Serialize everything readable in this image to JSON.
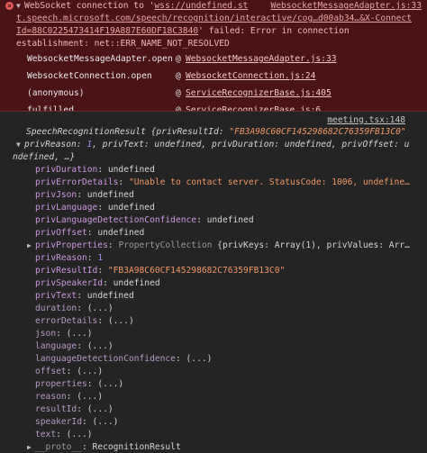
{
  "error": {
    "line1_prefix": "WebSocket connection to '",
    "line1_url": "wss://undefined.st",
    "line1_source": "WebsocketMessageAdapter.js:33",
    "line2": "t.speech.microsoft.com/speech/recognition/interactive/cog…d00ab34…&X-Connect",
    "line3_a": "Id=88C0225473414F19A887E60DF18C3840",
    "line3_b": "' failed: Error in connection",
    "line4": "establishment: net::ERR_NAME_NOT_RESOLVED",
    "stack": [
      {
        "fn": "WebsocketMessageAdapter.open",
        "at": "@",
        "src": "WebsocketMessageAdapter.js:33"
      },
      {
        "fn": "WebsocketConnection.open",
        "at": "@",
        "src": "WebsocketConnection.js:24"
      },
      {
        "fn": "(anonymous)",
        "at": "@",
        "src": "ServiceRecognizerBase.js:405"
      },
      {
        "fn": "fulfilled",
        "at": "@",
        "src": "ServiceRecognizerBase.js:6"
      }
    ]
  },
  "log": {
    "source": "meeting.tsx:148",
    "header_class": "SpeechRecognitionResult",
    "header_rest_a": " {privResultId: ",
    "header_id": "\"FB3A98C60CF145298682C76359FB13C0\"",
    "header_line2_a": "privReason: ",
    "header_line2_reason": "1",
    "header_line2_b": ", privText: undefined, privDuration: undefined, privOffset: u",
    "header_line3": "ndefined, …}",
    "props": [
      {
        "k": "privDuration",
        "v": "undefined",
        "t": "plain"
      },
      {
        "k": "privErrorDetails",
        "v": "\"Unable to contact server. StatusCode: 1006, undefine…",
        "t": "str"
      },
      {
        "k": "privJson",
        "v": "undefined",
        "t": "plain"
      },
      {
        "k": "privLanguage",
        "v": "undefined",
        "t": "plain"
      },
      {
        "k": "privLanguageDetectionConfidence",
        "v": "undefined",
        "t": "plain"
      },
      {
        "k": "privOffset",
        "v": "undefined",
        "t": "plain"
      }
    ],
    "properties_key": "privProperties",
    "properties_type": "PropertyCollection",
    "properties_rest": " {privKeys: Array(1), privValues: Arr…",
    "props2": [
      {
        "k": "privReason",
        "v": "1",
        "t": "num"
      },
      {
        "k": "privResultId",
        "v": "\"FB3A98C60CF145298682C76359FB13C0\"",
        "t": "str"
      },
      {
        "k": "privSpeakerId",
        "v": "undefined",
        "t": "plain"
      },
      {
        "k": "privText",
        "v": "undefined",
        "t": "plain"
      }
    ],
    "getters": [
      "duration",
      "errorDetails",
      "json",
      "language",
      "languageDetectionConfidence",
      "offset",
      "properties",
      "reason",
      "resultId",
      "speakerId",
      "text"
    ],
    "getter_value": "(...)",
    "proto_key": "__proto__",
    "proto_value": "RecognitionResult"
  },
  "colors": {
    "error_bg": "#4a1316",
    "console_bg": "#242424",
    "key": "#cc98e0",
    "string": "#f29766",
    "number": "#9b95f3"
  }
}
